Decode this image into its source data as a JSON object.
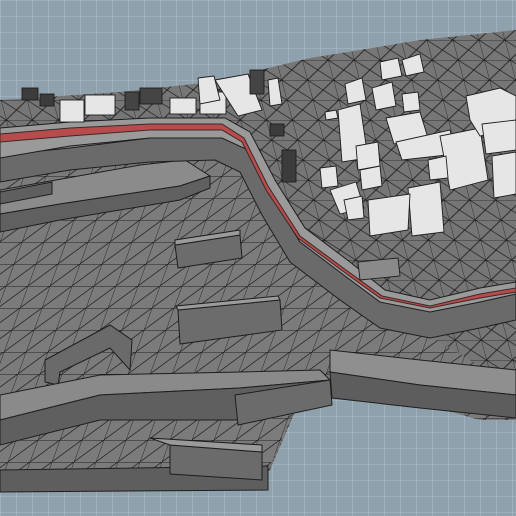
{
  "scene": {
    "description_visible_text": "",
    "colors": {
      "background_grid": "#8fa1ad",
      "grid_line": "#b8c7d1",
      "terrain": "#7a7a7a",
      "terrain_dark": "#5e5e5e",
      "wall_top": "#9a9a9a",
      "wall_side": "#6e6e6e",
      "road": "#b84b4b",
      "road_edge": "#3b2a2a",
      "building": "#e6e6e6",
      "building_shade": "#c9c9c9",
      "mesh_line": "#1e1e1e"
    }
  }
}
